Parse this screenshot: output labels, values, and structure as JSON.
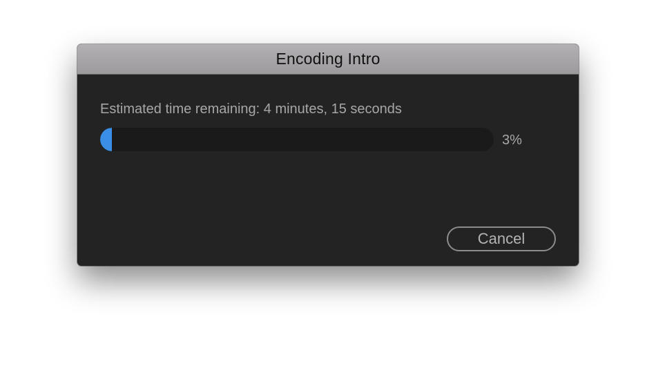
{
  "dialog": {
    "title": "Encoding Intro",
    "status_text": "Estimated time remaining: 4 minutes, 15 seconds",
    "progress": {
      "percent_value": 3,
      "percent_label": "3%"
    },
    "cancel_label": "Cancel"
  },
  "colors": {
    "accent": "#3a8ee6",
    "dialog_background": "#232323",
    "titlebar": "#a8a6a8",
    "text": "#a7a7a7"
  }
}
